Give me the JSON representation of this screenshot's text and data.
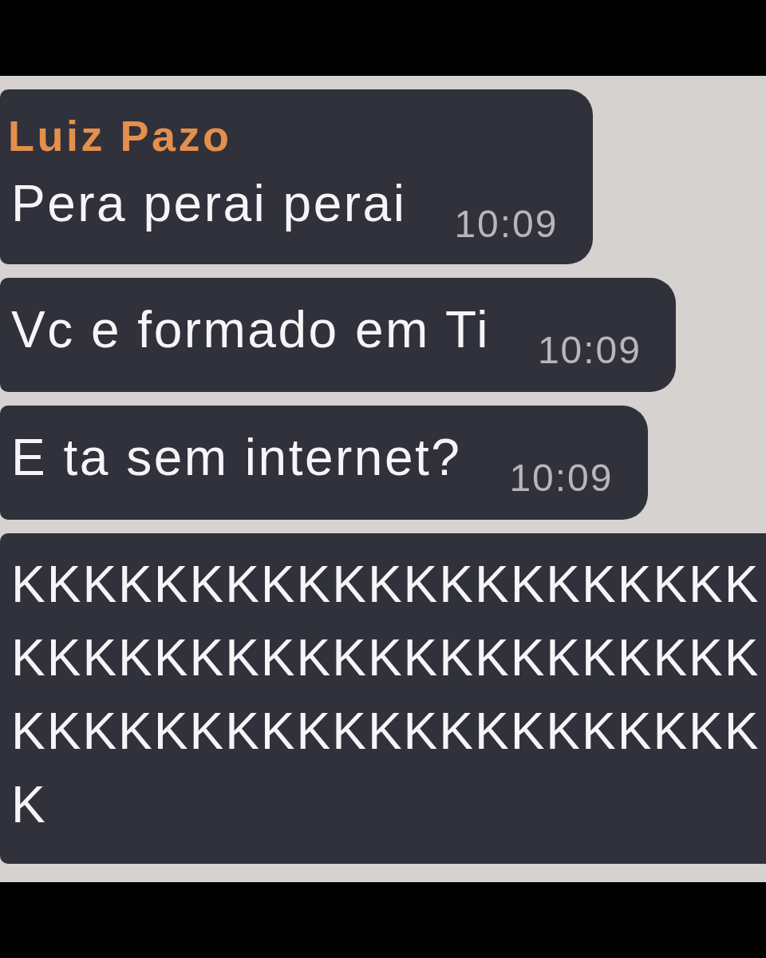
{
  "messages": [
    {
      "sender": "Luiz Pazo",
      "text": "Pera perai perai",
      "time": "10:09"
    },
    {
      "text": "Vc e formado em Ti",
      "time": "10:09"
    },
    {
      "text": "E ta sem internet?",
      "time": "10:09"
    },
    {
      "lines": [
        "KKKKKKKKKKKKKKKKKKKKK",
        "KKKKKKKKKKKKKKKKKKKKK",
        "KKKKKKKKKKKKKKKKKKKKK",
        "K"
      ]
    }
  ]
}
